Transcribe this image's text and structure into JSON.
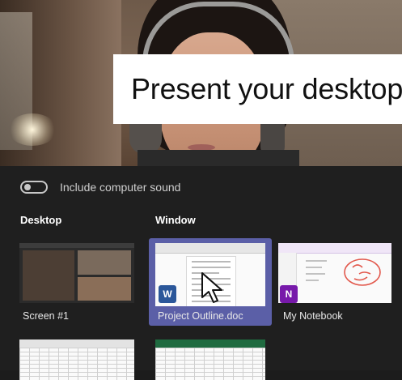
{
  "banner": {
    "title": "Present your desktop"
  },
  "sound_toggle": {
    "label": "Include computer sound",
    "state": "off"
  },
  "sections": {
    "desktop": "Desktop",
    "window": "Window"
  },
  "tiles": [
    {
      "label": "Screen #1",
      "kind": "screen",
      "selected": false
    },
    {
      "label": "Project Outline.doc",
      "kind": "word",
      "app_icon": "W",
      "selected": true
    },
    {
      "label": "My Notebook",
      "kind": "onenote",
      "app_icon": "N",
      "selected": false
    }
  ],
  "colors": {
    "selection": "#5b5fa7",
    "word": "#2b579a",
    "onenote": "#7719aa",
    "panel": "#1f1f1f"
  }
}
